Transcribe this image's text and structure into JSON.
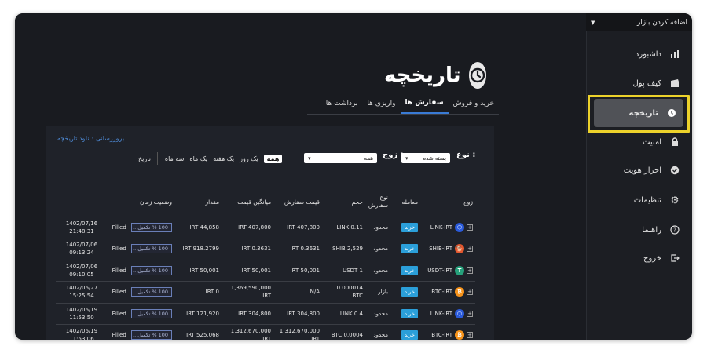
{
  "sidebar": {
    "market_select": "اضافه کردن بازار",
    "items": [
      {
        "label": "داشبورد",
        "icon": "bar-chart-icon"
      },
      {
        "label": "کیف پول",
        "icon": "wallet-icon"
      },
      {
        "label": "تاریخچه",
        "icon": "clock-icon",
        "active": true
      },
      {
        "label": "امنیت",
        "icon": "lock-icon"
      },
      {
        "label": "احراز هویت",
        "icon": "verified-icon"
      },
      {
        "label": "تنظیمات",
        "icon": "gear-icon"
      },
      {
        "label": "راهنما",
        "icon": "help-icon"
      },
      {
        "label": "خروج",
        "icon": "logout-icon"
      }
    ]
  },
  "main": {
    "title": "تاریخچه",
    "tabs": [
      "خرید و فروش",
      "سفارش ها",
      "واریزی ها",
      "برداشت ها"
    ],
    "active_tab": "سفارش ها",
    "refresh_link": "بروزرسانی دانلود تاریخچه",
    "filters": {
      "type_label": "نوع :",
      "type_value": "بسته شده",
      "pair_label": "زوج :",
      "pair_value": "همه",
      "date_label": "تاریخ",
      "date_options": [
        "همه",
        "یک روز",
        "یک هفته",
        "یک ماه",
        "سه ماه"
      ],
      "date_active": "همه"
    },
    "table": {
      "headers": {
        "pair": "زوج",
        "trade": "معامله",
        "order_type": "نوع سفارش",
        "volume": "حجم",
        "order_price": "قیمت سفارش",
        "avg_price": "میانگین قیمت",
        "amount": "مقدار",
        "status_time": "وضعیت زمان"
      },
      "rows": [
        {
          "pair": "LINK-IRT",
          "coin": "link",
          "trade": "خرید",
          "order_type": "محدود",
          "volume": "LINK 0.11",
          "order_price": "IRT 407,800",
          "avg_price": "IRT 407,800",
          "amount": "IRT 44,858",
          "progress": "100 % تکمیل ..",
          "status": "Filled",
          "date": "1402/07/16",
          "time": "21:48:31"
        },
        {
          "pair": "SHIB-IRT",
          "coin": "shib",
          "trade": "خرید",
          "order_type": "محدود",
          "volume": "SHIB 2,529",
          "order_price": "IRT 0.3631",
          "avg_price": "IRT 0.3631",
          "amount": "IRT 918.2799",
          "progress": "100 % تکمیل ..",
          "status": "Filled",
          "date": "1402/07/06",
          "time": "09:13:24"
        },
        {
          "pair": "USDT-IRT",
          "coin": "usdt",
          "trade": "خرید",
          "order_type": "محدود",
          "volume": "USDT 1",
          "order_price": "IRT 50,001",
          "avg_price": "IRT 50,001",
          "amount": "IRT 50,001",
          "progress": "100 % تکمیل ..",
          "status": "Filled",
          "date": "1402/07/06",
          "time": "09:10:05"
        },
        {
          "pair": "BTC-IRT",
          "coin": "btc",
          "trade": "خرید",
          "order_type": "بازار",
          "volume": "0.000014 BTC",
          "order_price": "N/A",
          "avg_price": "1,369,590,000 IRT",
          "amount": "IRT 0",
          "progress": "100 % تکمیل ..",
          "status": "Filled",
          "date": "1402/06/27",
          "time": "15:25:54"
        },
        {
          "pair": "LINK-IRT",
          "coin": "link",
          "trade": "خرید",
          "order_type": "محدود",
          "volume": "LINK 0.4",
          "order_price": "IRT 304,800",
          "avg_price": "IRT 304,800",
          "amount": "IRT 121,920",
          "progress": "100 % تکمیل ..",
          "status": "Filled",
          "date": "1402/06/19",
          "time": "11:53:50"
        },
        {
          "pair": "BTC-IRT",
          "coin": "btc",
          "trade": "خرید",
          "order_type": "محدود",
          "volume": "BTC 0.0004",
          "order_price": "1,312,670,000 IRT",
          "avg_price": "1,312,670,000 IRT",
          "amount": "IRT 525,068",
          "progress": "100 % تکمیل ..",
          "status": "Filled",
          "date": "1402/06/19",
          "time": "11:53:06"
        }
      ]
    }
  },
  "colors": {
    "accent": "#3a7bd5",
    "buy": "#2b9fd9",
    "highlight": "#ecd22b",
    "link": "#4f8ddb",
    "shib": "#e4572e",
    "usdt": "#26a17b",
    "btc": "#f7931a",
    "chainlink": "#2a5ada"
  }
}
